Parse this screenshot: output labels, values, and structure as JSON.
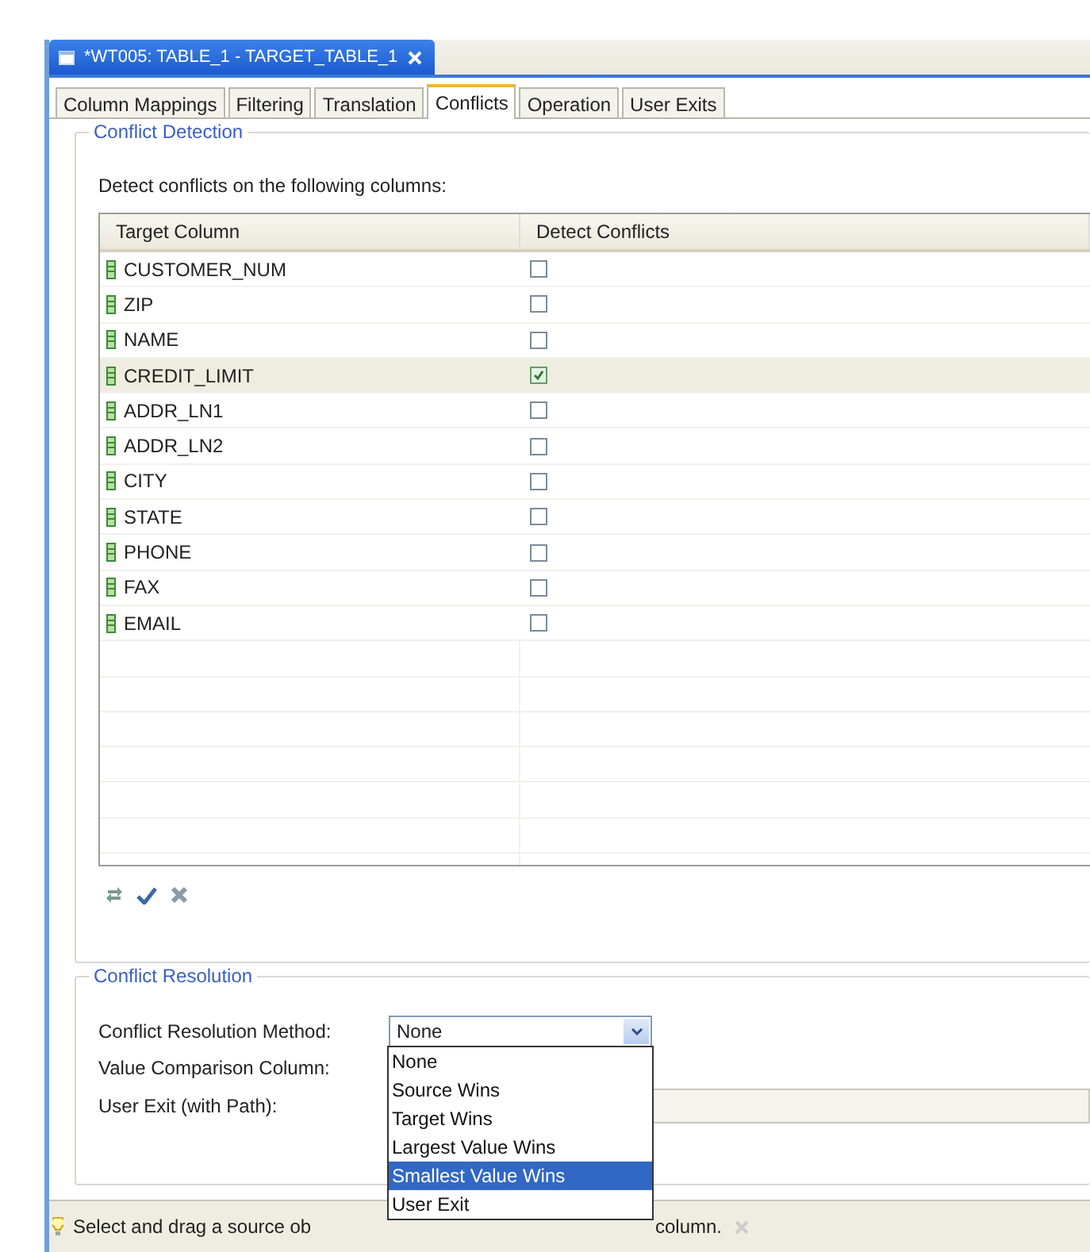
{
  "editor_tab": {
    "title": "*WT005: TABLE_1 - TARGET_TABLE_1"
  },
  "tabs": [
    {
      "label": "Column Mappings",
      "selected": false
    },
    {
      "label": "Filtering",
      "selected": false
    },
    {
      "label": "Translation",
      "selected": false
    },
    {
      "label": "Conflicts",
      "selected": true
    },
    {
      "label": "Operation",
      "selected": false
    },
    {
      "label": "User Exits",
      "selected": false
    }
  ],
  "conflict_detection": {
    "title": "Conflict Detection",
    "instruction": "Detect conflicts on the following columns:",
    "columns": [
      "Target Column",
      "Detect Conflicts"
    ],
    "rows": [
      {
        "name": "CUSTOMER_NUM",
        "checked": false,
        "selected": false
      },
      {
        "name": "ZIP",
        "checked": false,
        "selected": false
      },
      {
        "name": "NAME",
        "checked": false,
        "selected": false
      },
      {
        "name": "CREDIT_LIMIT",
        "checked": true,
        "selected": true
      },
      {
        "name": "ADDR_LN1",
        "checked": false,
        "selected": false
      },
      {
        "name": "ADDR_LN2",
        "checked": false,
        "selected": false
      },
      {
        "name": "CITY",
        "checked": false,
        "selected": false
      },
      {
        "name": "STATE",
        "checked": false,
        "selected": false
      },
      {
        "name": "PHONE",
        "checked": false,
        "selected": false
      },
      {
        "name": "FAX",
        "checked": false,
        "selected": false
      },
      {
        "name": "EMAIL",
        "checked": false,
        "selected": false
      }
    ]
  },
  "conflict_resolution": {
    "title": "Conflict Resolution",
    "method_label": "Conflict Resolution Method:",
    "method_value": "None",
    "options": [
      {
        "label": "None",
        "selected": false
      },
      {
        "label": "Source Wins",
        "selected": false
      },
      {
        "label": "Target Wins",
        "selected": false
      },
      {
        "label": "Largest Value Wins",
        "selected": false
      },
      {
        "label": "Smallest Value Wins",
        "selected": true
      },
      {
        "label": "User Exit",
        "selected": false
      }
    ],
    "value_comparison_label": "Value Comparison Column:",
    "user_exit_label": "User Exit (with Path):"
  },
  "status_bar": {
    "text_before": "Select and drag a source ob",
    "text_after": "column."
  }
}
